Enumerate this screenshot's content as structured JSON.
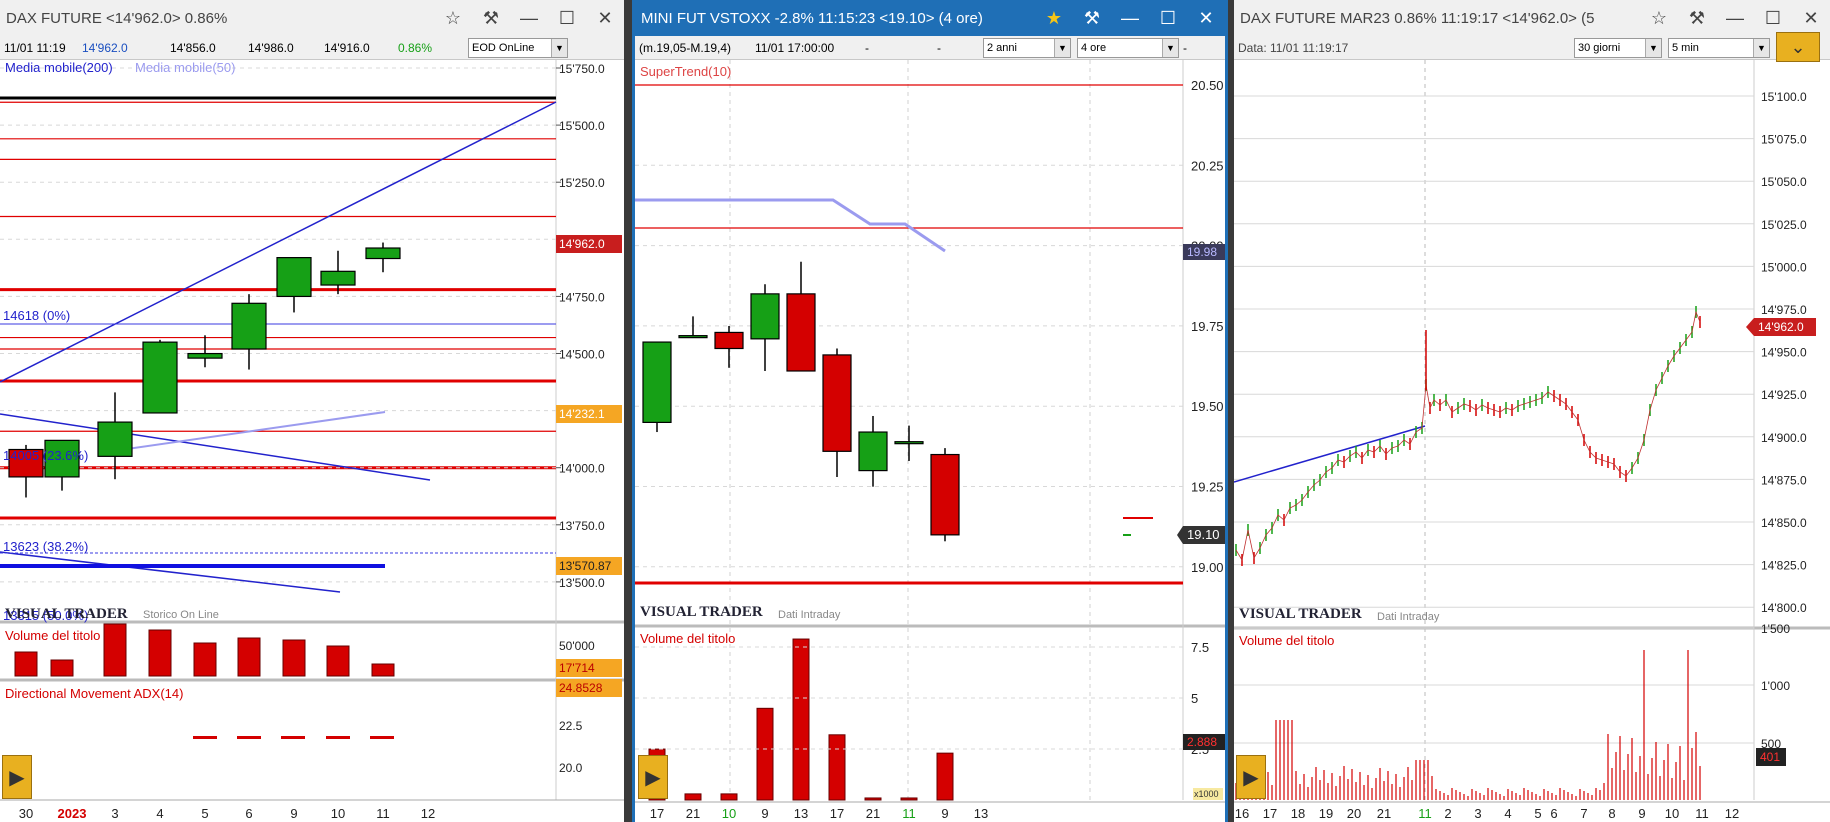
{
  "panels": {
    "left": {
      "title": "DAX FUTURE <14'962.0> 0.86%",
      "info": {
        "date": "11/01 11:19",
        "last": "14'962.0",
        "low": "14'856.0",
        "high": "14'986.0",
        "open": "14'916.0",
        "change": "0.86%",
        "feed": "EOD OnLine"
      },
      "ma200": "Media mobile(200)",
      "ma50": "Media mobile(50)",
      "fib_labels": [
        "14618 (0%)",
        "14005 (23.6%)",
        "13623 (38.2%)",
        "13315 (50.0%)"
      ],
      "price_ticks": [
        "15'750.0",
        "15'500.0",
        "15'250.0",
        "15'000.0",
        "14'750.0",
        "14'500.0",
        "14'250.0",
        "14'000.0",
        "13'750.0",
        "13'500.0"
      ],
      "tags": {
        "last": "14'962.0",
        "level1": "14'232.1",
        "level2": "13'570.87"
      },
      "brand": "VISUAL TRADER",
      "brand_sub": "Storico On Line",
      "volume_label": "Volume del titolo",
      "volume_tick": "50'000",
      "volume_tag": "17'714",
      "adx_label": "Directional Movement ADX(14)",
      "adx_tag": "24.8528",
      "adx_ticks": [
        "22.5",
        "20.0"
      ],
      "x_labels": [
        "30",
        "2023",
        "3",
        "4",
        "5",
        "6",
        "9",
        "10",
        "11",
        "12"
      ]
    },
    "middle": {
      "title": "MINI FUT VSTOXX -2.8% 11:15:23 <19.10> (4 ore)",
      "info": {
        "minmax": "(m.19,05-M.19,4)",
        "date": "11/01 17:00:00",
        "d1": "-",
        "d2": "-",
        "d3": "-",
        "period": "2 anni",
        "interval": "4 ore"
      },
      "indicator": "SuperTrend(10)",
      "price_ticks": [
        "20.50",
        "20.25",
        "20.00",
        "19.75",
        "19.50",
        "19.25",
        "19.00"
      ],
      "tags": {
        "supertrend": "19.98",
        "last": "19.10"
      },
      "brand": "VISUAL TRADER",
      "brand_sub": "Dati Intraday",
      "volume_label": "Volume del titolo",
      "volume_ticks": [
        "7.5",
        "5",
        "2.5"
      ],
      "volume_tag": "2.888",
      "volume_unit": "x1000",
      "x_labels": [
        "17",
        "21",
        "10",
        "9",
        "13",
        "17",
        "21",
        "11",
        "9",
        "13"
      ]
    },
    "right": {
      "title": "DAX FUTURE MAR23 0.86% 11:19:17 <14'962.0> (5",
      "info": {
        "date": "Data: 11/01 11:19:17",
        "period": "30 giorni",
        "interval": "5 min"
      },
      "price_ticks": [
        "15'100.0",
        "15'075.0",
        "15'050.0",
        "15'025.0",
        "15'000.0",
        "14'975.0",
        "14'950.0",
        "14'925.0",
        "14'900.0",
        "14'875.0",
        "14'850.0",
        "14'825.0",
        "14'800.0"
      ],
      "tags": {
        "last": "14'962.0"
      },
      "brand": "VISUAL TRADER",
      "brand_sub": "Dati Intraday",
      "volume_label": "Volume del titolo",
      "volume_ticks": [
        "1'500",
        "1'000",
        "500"
      ],
      "volume_tag": "401",
      "x_labels": [
        "16",
        "17",
        "18",
        "19",
        "20",
        "21",
        "11",
        "2",
        "3",
        "4",
        "5",
        "6",
        "7",
        "8",
        "9",
        "10",
        "11",
        "12"
      ]
    }
  },
  "colors": {
    "up": "#16a016",
    "down": "#d40000",
    "tag_red": "#c81e1e",
    "tag_orange": "#f5a623",
    "active_title": "#1f6fb6",
    "gold": "#e8b020"
  },
  "chart_data": [
    {
      "type": "candlestick",
      "title": "DAX FUTURE",
      "x": [
        "30",
        "2",
        "3",
        "4",
        "5",
        "6",
        "9",
        "10",
        "11"
      ],
      "open": [
        14080,
        13960,
        14050,
        14240,
        14480,
        14520,
        14750,
        14800,
        14916
      ],
      "high": [
        14100,
        14120,
        14330,
        14560,
        14580,
        14760,
        14920,
        14950,
        14986
      ],
      "low": [
        13870,
        13900,
        13950,
        14240,
        14440,
        14430,
        14680,
        14760,
        14856
      ],
      "close": [
        13960,
        14120,
        14200,
        14550,
        14500,
        14720,
        14920,
        14860,
        14962
      ],
      "ylim": [
        13400,
        15800
      ]
    },
    {
      "type": "candlestick",
      "title": "MINI FUT VSTOXX",
      "x": [
        "17",
        "21",
        "10",
        "9",
        "13",
        "17",
        "21",
        "11",
        "9"
      ],
      "open": [
        19.45,
        19.72,
        19.73,
        19.71,
        19.85,
        19.66,
        19.3,
        19.39,
        19.35
      ],
      "high": [
        19.55,
        19.78,
        19.75,
        19.88,
        19.95,
        19.68,
        19.47,
        19.44,
        19.37
      ],
      "low": [
        19.42,
        19.72,
        19.62,
        19.61,
        19.62,
        19.28,
        19.25,
        19.33,
        19.08
      ],
      "close": [
        19.7,
        19.72,
        19.68,
        19.85,
        19.61,
        19.36,
        19.42,
        19.39,
        19.1
      ],
      "ylim": [
        18.85,
        20.6
      ]
    }
  ]
}
